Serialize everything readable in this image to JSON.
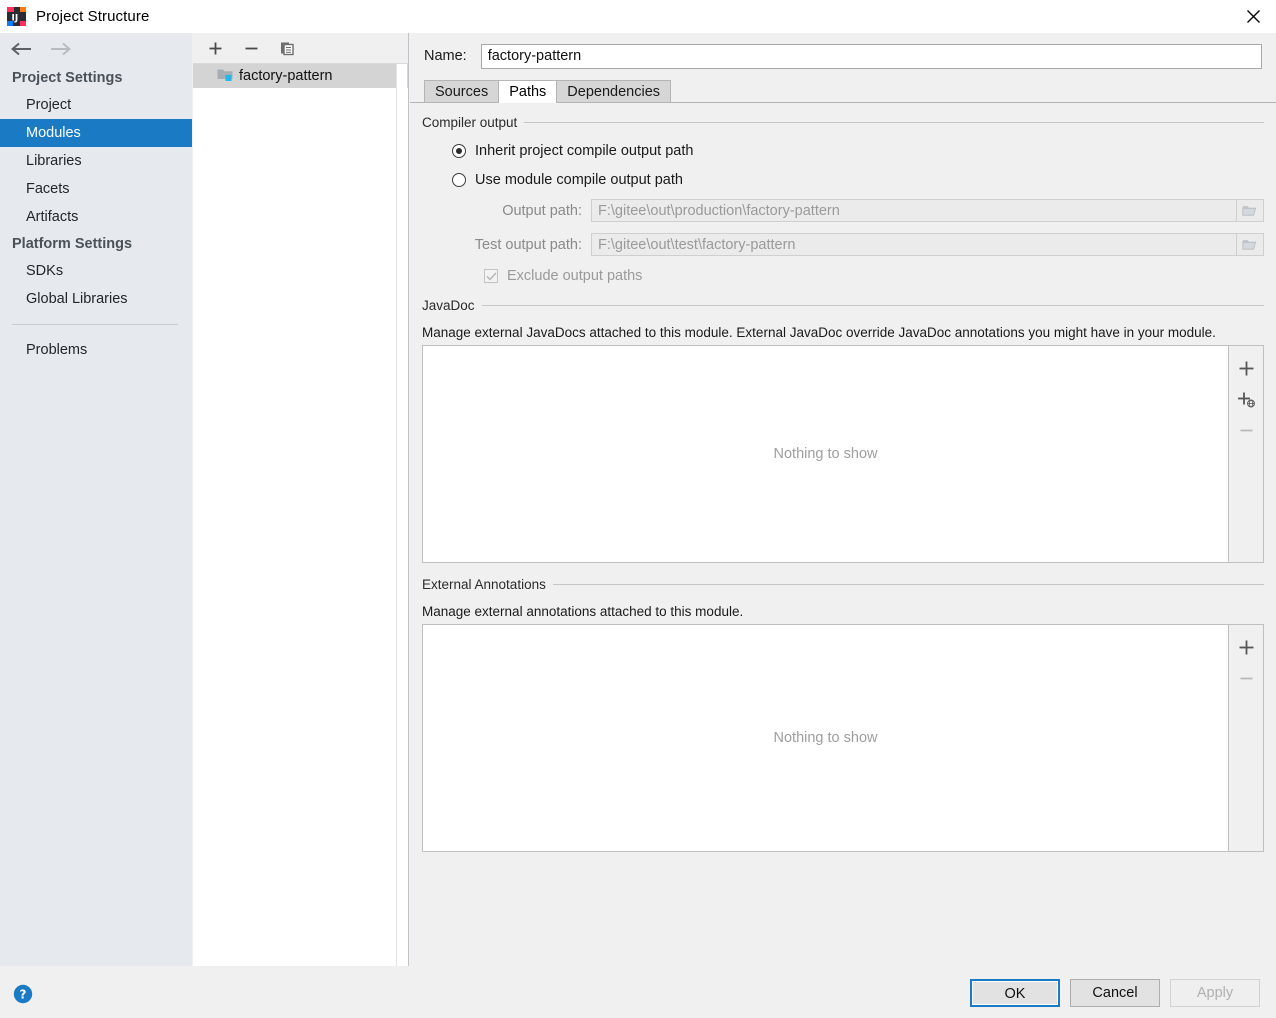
{
  "window": {
    "title": "Project Structure",
    "app_icon": "intellij-idea-logo",
    "close_label": "×"
  },
  "sidebar": {
    "back_icon": "arrow-left-icon",
    "forward_icon": "arrow-right-icon",
    "groups": [
      {
        "title": "Project Settings",
        "items": [
          {
            "label": "Project",
            "selected": false
          },
          {
            "label": "Modules",
            "selected": true
          },
          {
            "label": "Libraries",
            "selected": false
          },
          {
            "label": "Facets",
            "selected": false
          },
          {
            "label": "Artifacts",
            "selected": false
          }
        ]
      },
      {
        "title": "Platform Settings",
        "items": [
          {
            "label": "SDKs",
            "selected": false
          },
          {
            "label": "Global Libraries",
            "selected": false
          }
        ]
      }
    ],
    "problems_label": "Problems",
    "selected_color": "#1a7bc4"
  },
  "tree_panel": {
    "toolbar": [
      {
        "name": "add-module-button",
        "icon": "plus-icon"
      },
      {
        "name": "remove-module-button",
        "icon": "minus-icon"
      },
      {
        "name": "copy-module-button",
        "icon": "copy-icon"
      }
    ],
    "modules": [
      {
        "label": "factory-pattern",
        "icon": "module-folder-icon",
        "selected": true
      }
    ]
  },
  "main": {
    "name_label": "Name:",
    "name_value": "factory-pattern",
    "name_placeholder": "",
    "tabs": [
      {
        "label": "Sources",
        "active": false
      },
      {
        "label": "Paths",
        "active": true
      },
      {
        "label": "Dependencies",
        "active": false
      }
    ],
    "compiler_output": {
      "title": "Compiler output",
      "inherit_label": "Inherit project compile output path",
      "inherit_checked": true,
      "module_label": "Use module compile output path",
      "module_checked": false,
      "output_path_label": "Output path:",
      "output_path_value": "F:\\gitee\\out\\production\\factory-pattern",
      "test_output_path_label": "Test output path:",
      "test_output_path_value": "F:\\gitee\\out\\test\\factory-pattern",
      "exclude_label": "Exclude output paths",
      "exclude_checked": true,
      "browse_icon": "folder-browse-icon"
    },
    "javadoc": {
      "title": "JavaDoc",
      "description": "Manage external JavaDocs attached to this module. External JavaDoc override JavaDoc annotations you might have in your module.",
      "empty_text": "Nothing to show",
      "tools": [
        {
          "name": "add-javadoc-path-button",
          "icon": "plus-icon"
        },
        {
          "name": "add-javadoc-url-button",
          "icon": "plus-globe-icon"
        },
        {
          "name": "remove-javadoc-button",
          "icon": "minus-icon"
        }
      ]
    },
    "external_annotations": {
      "title": "External Annotations",
      "description": "Manage external annotations attached to this module.",
      "empty_text": "Nothing to show",
      "tools": [
        {
          "name": "add-annotation-button",
          "icon": "plus-icon"
        },
        {
          "name": "remove-annotation-button",
          "icon": "minus-icon"
        }
      ]
    }
  },
  "footer": {
    "help_icon": "help-question-icon",
    "ok_label": "OK",
    "cancel_label": "Cancel",
    "apply_label": "Apply"
  }
}
